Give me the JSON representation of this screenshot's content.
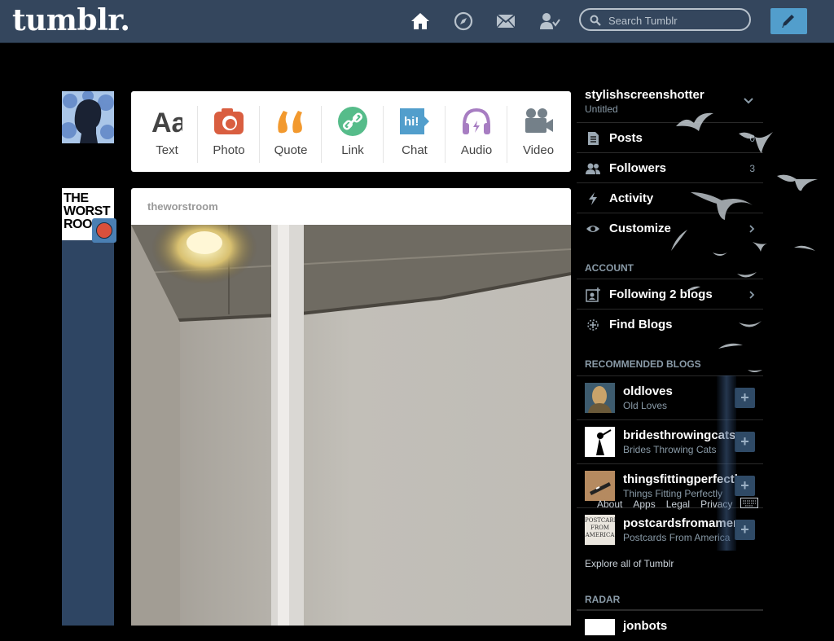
{
  "header": {
    "logo": "tumblr.",
    "search_placeholder": "Search Tumblr",
    "nav_icons": [
      "home-icon",
      "explore-icon",
      "inbox-icon",
      "account-icon"
    ],
    "compose_icon": "pencil-icon"
  },
  "colors": {
    "header_bg": "#34465d",
    "accent": "#529ecc",
    "background": "#000000",
    "text_icon": "#444444",
    "photo_icon": "#ff4500",
    "quote_icon": "#ff8a00",
    "link_icon": "#56bc8a",
    "chat_icon": "#529ecc",
    "audio_icon": "#a77dc2",
    "video_icon": "#748089"
  },
  "post_types": [
    {
      "label": "Text",
      "icon": "text-icon"
    },
    {
      "label": "Photo",
      "icon": "camera-icon"
    },
    {
      "label": "Quote",
      "icon": "quote-icon"
    },
    {
      "label": "Link",
      "icon": "link-icon"
    },
    {
      "label": "Chat",
      "icon": "chat-icon"
    },
    {
      "label": "Audio",
      "icon": "headphones-icon"
    },
    {
      "label": "Video",
      "icon": "video-camera-icon"
    }
  ],
  "post": {
    "blog": "theworstroom",
    "avatar_text": "THE WORST ROOM"
  },
  "sidebar": {
    "blog_name": "stylishscreenshotter",
    "blog_title": "Untitled",
    "menu": [
      {
        "label": "Posts",
        "count": "0",
        "icon": "posts-icon"
      },
      {
        "label": "Followers",
        "count": "3",
        "icon": "followers-icon"
      },
      {
        "label": "Activity",
        "count": "",
        "icon": "activity-icon"
      },
      {
        "label": "Customize",
        "count": "",
        "icon": "eye-icon"
      }
    ],
    "account_heading": "ACCOUNT",
    "account_items": [
      {
        "label": "Following 2 blogs",
        "icon": "following-icon"
      },
      {
        "label": "Find Blogs",
        "icon": "find-blogs-icon"
      }
    ],
    "recommended_heading": "RECOMMENDED BLOGS",
    "recommended": [
      {
        "name": "oldloves",
        "title": "Old Loves"
      },
      {
        "name": "bridesthrowingcats",
        "title": "Brides Throwing Cats"
      },
      {
        "name": "thingsfittingperfectly",
        "title": "Things Fitting Perfectly"
      },
      {
        "name": "postcardsfromamerica",
        "title": "Postcards From America",
        "avatar_text": "POSTCARDS FROM AMERICA"
      }
    ],
    "follow_symbol": "+",
    "explore": "Explore all of Tumblr",
    "radar_heading": "RADAR",
    "radar_blog": "jonbots"
  },
  "footer": {
    "links": [
      "About",
      "Apps",
      "Legal",
      "Privacy"
    ]
  }
}
